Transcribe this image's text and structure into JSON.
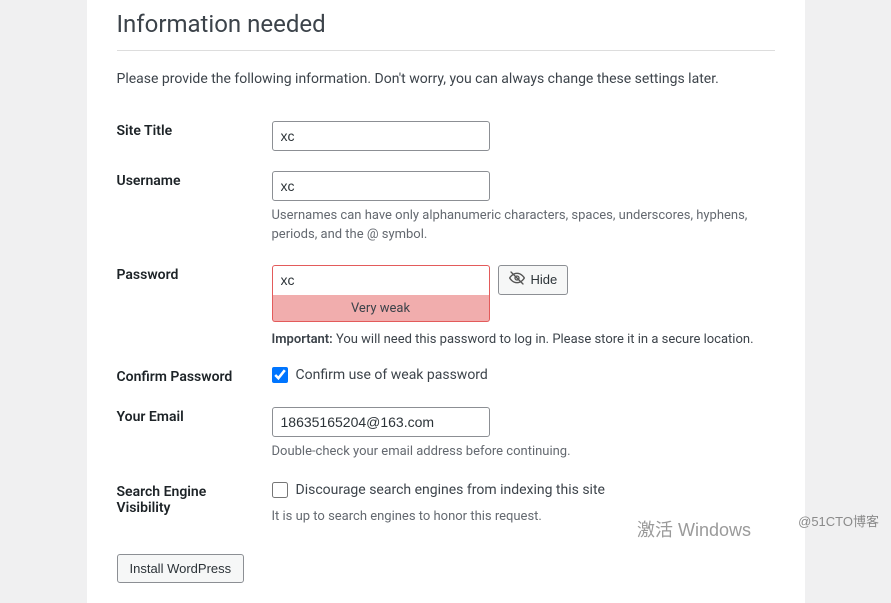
{
  "heading": "Information needed",
  "intro": "Please provide the following information. Don't worry, you can always change these settings later.",
  "fields": {
    "site_title": {
      "label": "Site Title",
      "value": "xc"
    },
    "username": {
      "label": "Username",
      "value": "xc",
      "desc": "Usernames can have only alphanumeric characters, spaces, underscores, hyphens, periods, and the @ symbol."
    },
    "password": {
      "label": "Password",
      "value": "xc",
      "strength": "Very weak",
      "hide_btn": "Hide",
      "important_label": "Important:",
      "important_text": " You will need this password to log in. Please store it in a secure location."
    },
    "confirm": {
      "label": "Confirm Password",
      "checkbox_label": "Confirm use of weak password"
    },
    "email": {
      "label": "Your Email",
      "value": "18635165204@163.com",
      "desc": "Double-check your email address before continuing."
    },
    "search": {
      "label": "Search Engine Visibility",
      "checkbox_label": "Discourage search engines from indexing this site",
      "desc": "It is up to search engines to honor this request."
    }
  },
  "submit": "Install WordPress",
  "watermark_win": "激活 Windows",
  "watermark_blog": "@51CTO博客"
}
